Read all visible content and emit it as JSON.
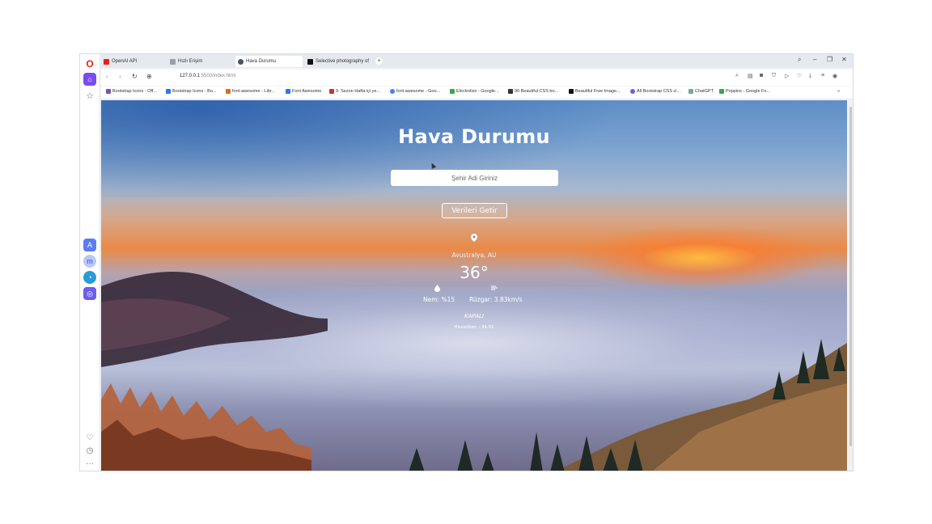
{
  "browser": {
    "tabs": [
      {
        "label": "OpenAI API",
        "color": "#e2231a"
      },
      {
        "label": "Hızlı Erişim",
        "color": "#7a7f8c"
      },
      {
        "label": "Hava Durumu",
        "color": "#4a5560"
      },
      {
        "label": "Selective photography of",
        "color": "#111111"
      }
    ],
    "new_tab": "+",
    "controls": {
      "search": "⌕",
      "minimize": "–",
      "restore": "❐",
      "close": "✕"
    },
    "address": {
      "host": "127.0.0.1",
      "path": ":5500/index.html"
    },
    "nav": {
      "back": "‹",
      "forward": "›",
      "reload": "↻",
      "site": "⊕"
    }
  },
  "bookmarks": [
    {
      "label": "Bootstrap Icons · Off...",
      "color": "#7952b3"
    },
    {
      "label": "Bootstrap Icons - Bo...",
      "color": "#2a7ae4"
    },
    {
      "label": "font-awesome - Libr...",
      "color": "#e06c1a"
    },
    {
      "label": "Font Awesome",
      "color": "#2a7ae4"
    },
    {
      "label": "9. Sezon Hafta içi ye...",
      "color": "#c0392b"
    },
    {
      "label": "font awesome - Goo...",
      "color": "#4285f4"
    },
    {
      "label": "Electrolize - Google...",
      "color": "#34a853"
    },
    {
      "label": "90 Beautiful CSS bo...",
      "color": "#333333"
    },
    {
      "label": "Beautiful Free Image...",
      "color": "#111111"
    },
    {
      "label": "All Bootstrap CSS cl...",
      "color": "#6d5cf0"
    },
    {
      "label": "ChatGPT",
      "color": "#74aa9c"
    },
    {
      "label": "Poppins - Google Fo...",
      "color": "#34a853"
    }
  ],
  "bookmarks_more": "»",
  "app": {
    "title": "Hava Durumu",
    "search_placeholder": "Şehir Adi Giriniz",
    "button_label": "Verileri Getir",
    "location": "Avustralya, AU",
    "temperature": "36°",
    "humidity": "Nem: %15",
    "wind": "Rüzgar: 3.83km/s",
    "description": "KAPALI",
    "feels_like": "Hissedilen : 34.01"
  },
  "icons": {
    "pin": "location-pin-icon",
    "drop": "humidity-drop-icon",
    "wind": "wind-icon"
  }
}
